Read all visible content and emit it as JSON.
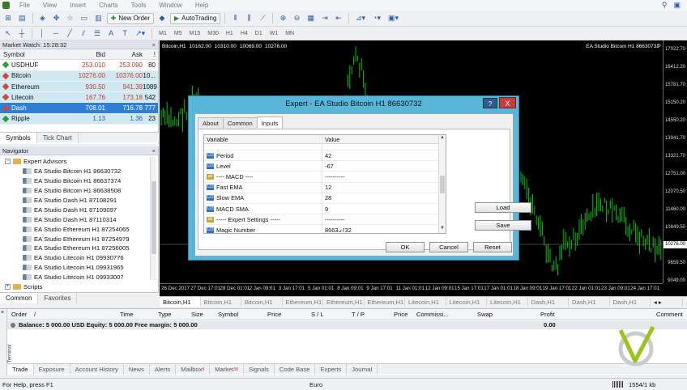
{
  "menu": [
    "File",
    "View",
    "Insert",
    "Charts",
    "Tools",
    "Window",
    "Help"
  ],
  "toolbar": {
    "new_order": "New Order",
    "auto_trading": "AutoTrading",
    "timeframes": [
      "M1",
      "M5",
      "M15",
      "M30",
      "H1",
      "H4",
      "D1",
      "W1",
      "MN"
    ]
  },
  "market_watch": {
    "title": "Market Watch: 15:28:32",
    "headers": {
      "symbol": "Symbol",
      "bid": "Bid",
      "ask": "Ask",
      "spread": "!"
    },
    "rows": [
      {
        "symbol": "USDHUF",
        "bid": "253.010",
        "ask": "253.090",
        "spread": "80"
      },
      {
        "symbol": "Bitcoin",
        "bid": "10276.00",
        "ask": "10376.00",
        "spread": "10..."
      },
      {
        "symbol": "Ethereum",
        "bid": "930.50",
        "ask": "941.39",
        "spread": "1089"
      },
      {
        "symbol": "Litecoin",
        "bid": "167.76",
        "ask": "173.18",
        "spread": "542"
      },
      {
        "symbol": "Dash",
        "bid": "708.01",
        "ask": "716.78",
        "spread": "777"
      },
      {
        "symbol": "Ripple",
        "bid": "1.13",
        "ask": "1.36",
        "spread": "23"
      }
    ],
    "tabs": [
      "Symbols",
      "Tick Chart"
    ]
  },
  "navigator": {
    "title": "Navigator",
    "expert_advisors": "Expert Advisors",
    "items": [
      "EA Studio Bitcoin H1 86630732",
      "EA Studio Bitcoin H1 86637374",
      "EA Studio Bitcoin H1 86638508",
      "EA Studio Dash H1 87108291",
      "EA Studio Dash H1 87109097",
      "EA Studio Dash H1 87110314",
      "EA Studio Ethereum H1 87254065",
      "EA Studio Ethereum H1 87254979",
      "EA Studio Ethereum H1 87256005",
      "EA Studio Litecoin H1 09930776",
      "EA Studio Litecoin H1 09931965",
      "EA Studio Litecoin H1 09933007"
    ],
    "scripts": "Scripts",
    "tabs": [
      "Common",
      "Favorites"
    ]
  },
  "chart": {
    "info": [
      "Bitcoin,H1",
      "10162.00",
      "10310.00",
      "10069.00",
      "10276.00"
    ],
    "title_right": "EA Studio Bitcoin H1 86630732",
    "price_labels": [
      "17022.70",
      "16412.20",
      "15781.70",
      "15150.20",
      "14550.20",
      "13941.70",
      "13321.70",
      "12751.00",
      "12070.50",
      "11460.00",
      "10849.50",
      "10276.00",
      "9659.50",
      "9049.00"
    ],
    "current_price": "10276.00",
    "time_labels": [
      "26 Dec 2017",
      "27 Dec 17:01",
      "28 Dec 01:01",
      "2 Jan 09:01",
      "3 Jan 17:01",
      "5 Jan 01:01",
      "8 Jan 09:01",
      "9 Jan 17:01",
      "11 Jan 01:01",
      "12 Jan 09:01",
      "15 Jan 17:01",
      "17 Jan 01:01",
      "18 Jan 09:01",
      "19 Jan 17:01",
      "22 Jan 01:01",
      "23 Jan 09:01",
      "24 Jan 17:01"
    ],
    "tabs": [
      "Bitcoin,H1",
      "Bitcoin,H1",
      "Bitcoin,H1",
      "Ethereum,H1",
      "Ethereum,H1",
      "Ethereum,H1",
      "Litecoin,H1",
      "Litecoin,H1",
      "Litecoin,H1",
      "Dash,H1",
      "Dash,H1",
      "Dash,H1"
    ]
  },
  "dialog": {
    "title": "Expert - EA Studio Bitcoin H1 86630732",
    "help": "?",
    "close": "X",
    "tabs": [
      "About",
      "Common",
      "Inputs"
    ],
    "headers": {
      "variable": "Variable",
      "value": "Value"
    },
    "params": [
      {
        "name": "Period",
        "value": "42",
        "icon": "123"
      },
      {
        "name": "Level",
        "value": "-67",
        "icon": "123"
      },
      {
        "name": "---- MACD ----",
        "value": "----------",
        "icon": "ab"
      },
      {
        "name": "Fast EMA",
        "value": "12",
        "icon": "123"
      },
      {
        "name": "Slow EMA",
        "value": "28",
        "icon": "123"
      },
      {
        "name": "MACD SMA",
        "value": "9",
        "icon": "123"
      },
      {
        "name": "----- Expert Settings -----",
        "value": "----------",
        "icon": "ab"
      },
      {
        "name": "Magic Number",
        "value": "86630732",
        "icon": "123"
      }
    ],
    "load": "Load",
    "save": "Save",
    "ok": "OK",
    "cancel": "Cancel",
    "reset": "Reset"
  },
  "terminal": {
    "headers": [
      "Order",
      "/",
      "Time",
      "Type",
      "Size",
      "Symbol",
      "Price",
      "S / L",
      "T / P",
      "Price",
      "Commissi...",
      "Swap",
      "Profit",
      "Comment"
    ],
    "balance": "Balance: 5 000.00 USD  Equity: 5 000.00  Free margin: 5 000.00",
    "profit": "0.00",
    "side": "Terminal",
    "tabs": [
      {
        "label": "Trade"
      },
      {
        "label": "Exposure"
      },
      {
        "label": "Account History"
      },
      {
        "label": "News"
      },
      {
        "label": "Alerts"
      },
      {
        "label": "Mailbox",
        "badge": "8"
      },
      {
        "label": "Market",
        "badge": "38"
      },
      {
        "label": "Signals"
      },
      {
        "label": "Code Base"
      },
      {
        "label": "Experts"
      },
      {
        "label": "Journal"
      }
    ]
  },
  "status": {
    "help": "For Help, press F1",
    "profile": "Euro",
    "traffic": "1554/1 kb"
  },
  "colors": {
    "accent": "#2f7ed8",
    "dialog_frame": "#58b7d9",
    "chart_bg": "#000000",
    "candle": "#00c800"
  }
}
